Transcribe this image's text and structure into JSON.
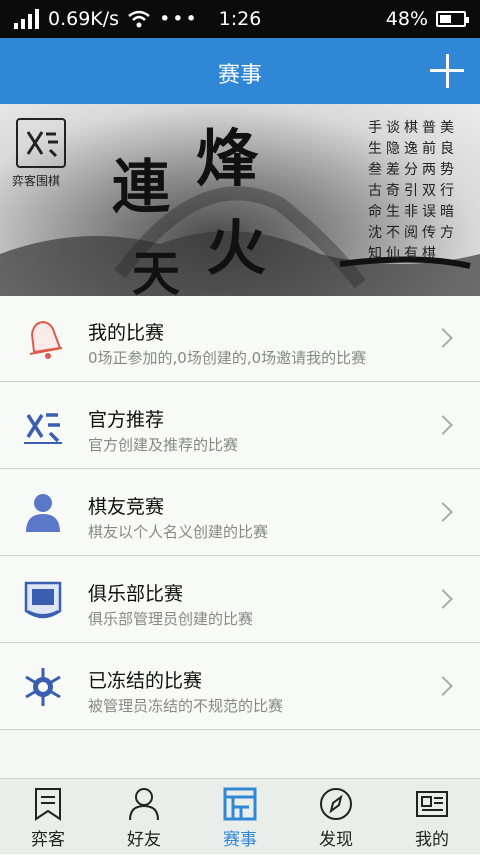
{
  "status": {
    "network_speed": "0.69K/s",
    "time": "1:26",
    "battery": "48%"
  },
  "header": {
    "title": "赛事"
  },
  "banner": {
    "calligraphy": [
      "烽",
      "連",
      "火",
      "天"
    ],
    "logo_caption": "弈客围棋",
    "poem": "手谈棋普美生隐逸前良叁差分两势古奇引双行命生非误暗沈不阅传方知仙有棋"
  },
  "list": [
    {
      "title": "我的比赛",
      "subtitle": "0场正参加的,0场创建的,0场邀请我的比赛"
    },
    {
      "title": "官方推荐",
      "subtitle": "官方创建及推荐的比赛"
    },
    {
      "title": "棋友竞赛",
      "subtitle": "棋友以个人名义创建的比赛"
    },
    {
      "title": "俱乐部比赛",
      "subtitle": "俱乐部管理员创建的比赛"
    },
    {
      "title": "已冻结的比赛",
      "subtitle": "被管理员冻结的不规范的比赛"
    }
  ],
  "tabs": [
    {
      "label": "弈客",
      "icon": "bookmark-icon"
    },
    {
      "label": "好友",
      "icon": "person-icon"
    },
    {
      "label": "赛事",
      "icon": "event-icon",
      "active": true
    },
    {
      "label": "发现",
      "icon": "compass-icon"
    },
    {
      "label": "我的",
      "icon": "profile-card-icon"
    }
  ],
  "colors": {
    "primary": "#2f87d6",
    "icon_red": "#e05a4a",
    "icon_blue": "#3a5fb0"
  }
}
